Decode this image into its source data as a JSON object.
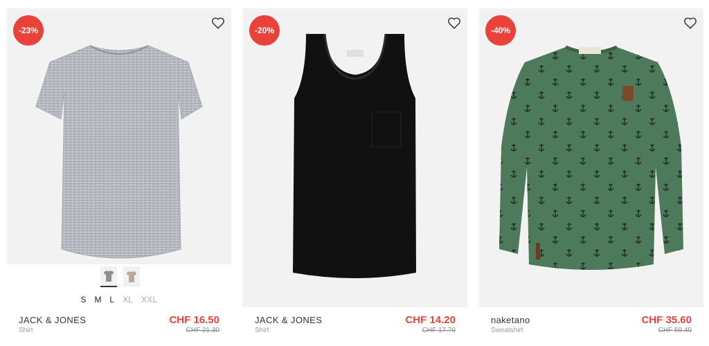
{
  "products": [
    {
      "badge": "-23%",
      "brand": "JACK & JONES",
      "category": "Shirt",
      "price": "CHF 16.50",
      "old_price": "CHF 21.30",
      "sizes": [
        {
          "label": "S",
          "available": true
        },
        {
          "label": "M",
          "available": true
        },
        {
          "label": "L",
          "available": true
        },
        {
          "label": "XL",
          "available": false
        },
        {
          "label": "XXL",
          "available": false
        }
      ],
      "swatch_colors": [
        "#8b8e92",
        "#b9a89c"
      ]
    },
    {
      "badge": "-20%",
      "brand": "JACK & JONES",
      "category": "Shirt",
      "price": "CHF 14.20",
      "old_price": "CHF 17.70"
    },
    {
      "badge": "-40%",
      "brand": "naketano",
      "category": "Sweatshirt",
      "price": "CHF 35.60",
      "old_price": "CHF 59.40"
    }
  ],
  "colors": {
    "sale": "#e8423b",
    "image_bg": "#f2f2f2"
  },
  "icons": {
    "wishlist": "heart-outline-icon"
  }
}
